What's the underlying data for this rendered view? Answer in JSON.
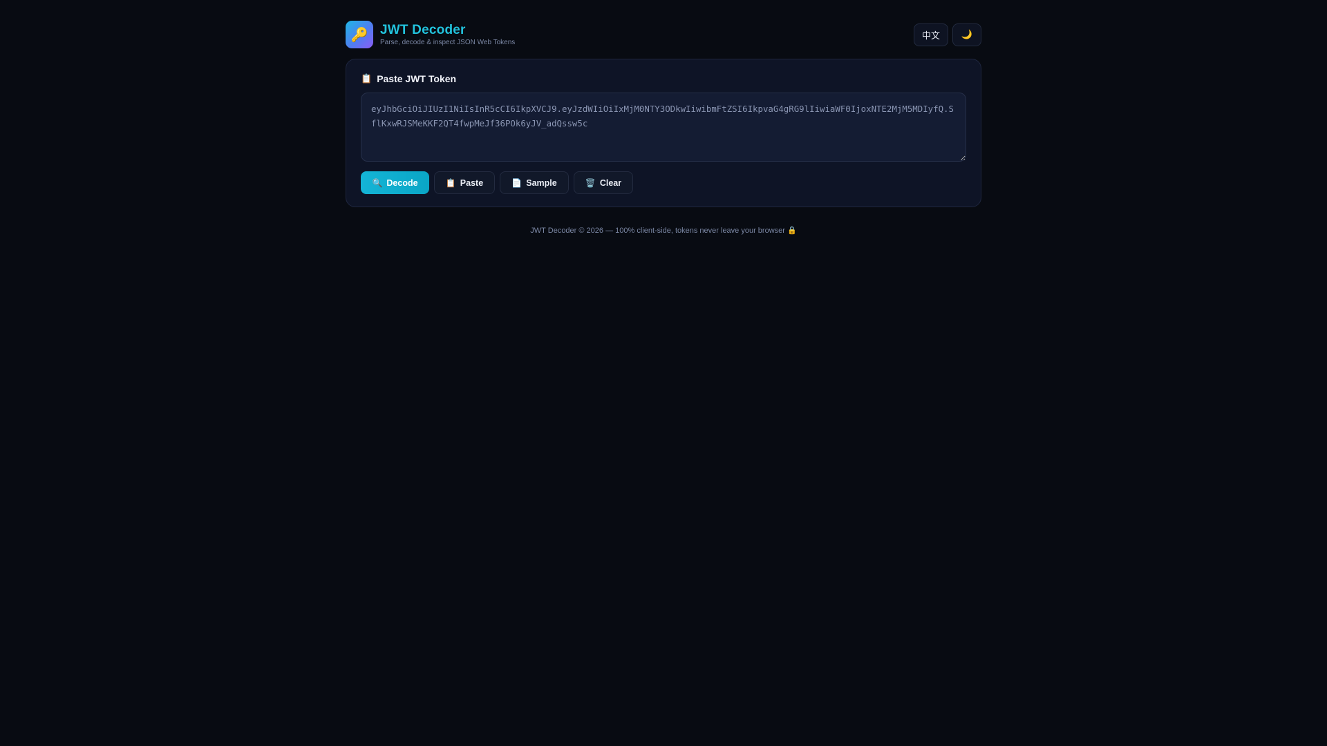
{
  "header": {
    "logo_icon": "key-icon",
    "logo_glyph": "🔑",
    "title": "JWT Decoder",
    "subtitle": "Parse, decode & inspect JSON Web Tokens",
    "lang_label": "中文",
    "theme_icon": "moon-icon",
    "theme_glyph": "🌙"
  },
  "input_card": {
    "icon": "clipboard-icon",
    "icon_glyph": "📋",
    "title": "Paste JWT Token",
    "token_value": "eyJhbGciOiJIUzI1NiIsInR5cCI6IkpXVCJ9.eyJzdWIiOiIxMjM0NTY3ODkwIiwibmFtZSI6IkpvaG4gRG9lIiwiaWF0IjoxNTE2MjM5MDIyfQ.SflKxwRJSMeKKF2QT4fwpMeJf36POk6yJV_adQssw5c",
    "buttons": {
      "decode": {
        "label": "Decode",
        "icon": "search-icon",
        "glyph": "🔍"
      },
      "paste": {
        "label": "Paste",
        "icon": "clipboard-icon",
        "glyph": "📋"
      },
      "sample": {
        "label": "Sample",
        "icon": "document-icon",
        "glyph": "📄"
      },
      "clear": {
        "label": "Clear",
        "icon": "trash-icon",
        "glyph": "🗑️"
      }
    }
  },
  "footer": {
    "text": "JWT Decoder © 2026 — 100% client-side, tokens never leave your browser",
    "lock_icon": "lock-icon",
    "lock_glyph": "🔒"
  },
  "colors": {
    "background": "#080b12",
    "accent": "#22c3dd",
    "decode_button": "#0aa6c6",
    "card": "#0e1426"
  }
}
